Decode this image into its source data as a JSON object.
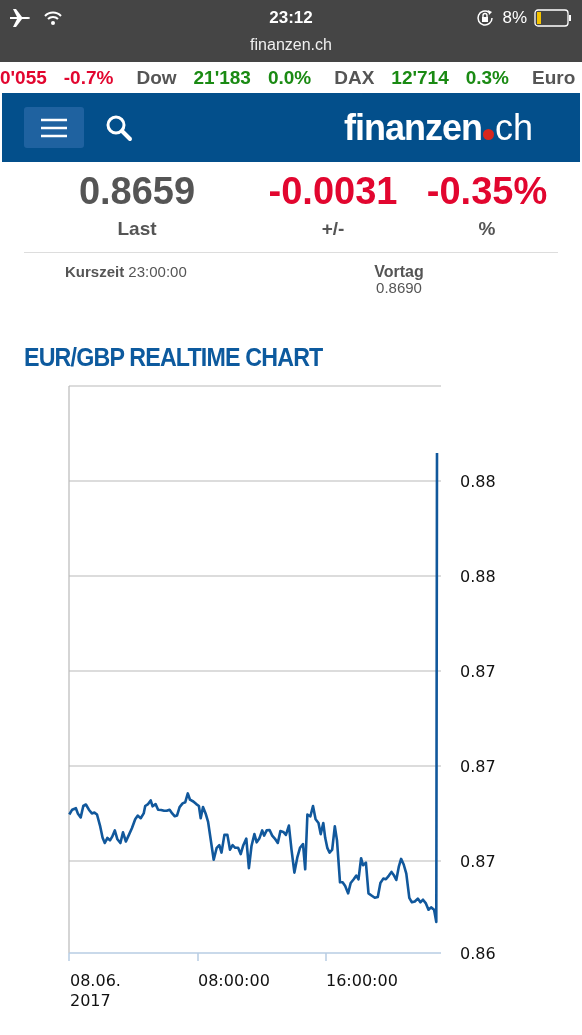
{
  "status_bar": {
    "time": "23:12",
    "battery": "8%",
    "url": "finanzen.ch"
  },
  "ticker": [
    {
      "text": "0'055",
      "kind": "down"
    },
    {
      "text": "-0.7%",
      "kind": "down"
    },
    {
      "text": "Dow",
      "kind": "name"
    },
    {
      "text": "21'183",
      "kind": "up"
    },
    {
      "text": "0.0%",
      "kind": "up"
    },
    {
      "text": "DAX",
      "kind": "name"
    },
    {
      "text": "12'714",
      "kind": "up"
    },
    {
      "text": "0.3%",
      "kind": "up"
    },
    {
      "text": "Euro",
      "kind": "name"
    }
  ],
  "header": {
    "logo": "finanzen",
    "logo_suffix": "ch"
  },
  "quote": {
    "stats": [
      {
        "value": "0.8659",
        "label": "Last",
        "kind": "neutral"
      },
      {
        "value": "-0.0031",
        "label": "+/-",
        "kind": "down"
      },
      {
        "value": "-0.35%",
        "label": "%",
        "kind": "down"
      }
    ],
    "time_label": "Kurszeit",
    "time": "23:00:00",
    "previous_label": "Vortag",
    "previous": "0.8690"
  },
  "chart": {
    "title": "EUR/GBP REALTIME CHART",
    "y_axis_labels": [
      "0.88",
      "0.88",
      "0.87",
      "0.87",
      "0.87",
      "0.86"
    ],
    "x_axis_labels": [
      [
        "08.06.",
        "2017"
      ],
      [
        "08:00:00"
      ],
      [
        "16:00:00"
      ]
    ]
  }
}
